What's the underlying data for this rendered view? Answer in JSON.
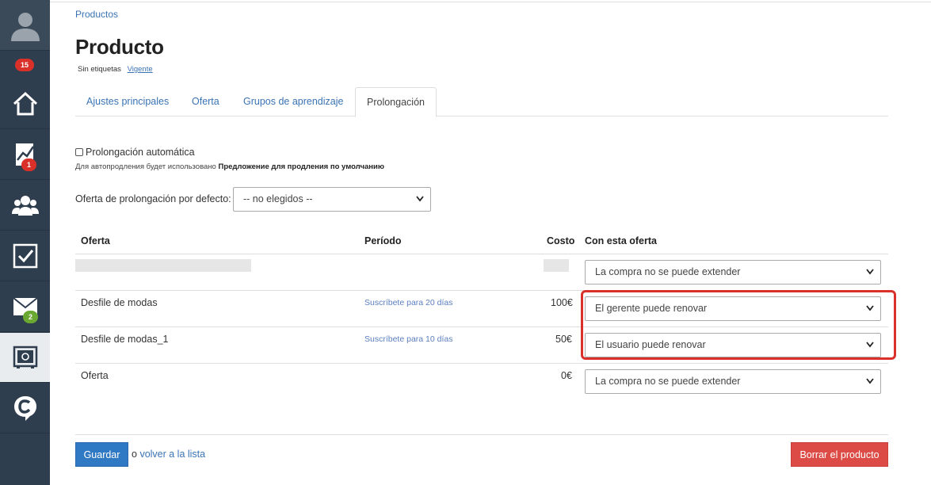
{
  "sidebar": {
    "items": [
      {
        "name": "avatar",
        "icon": "user-avatar-icon"
      },
      {
        "name": "home",
        "icon": "home-icon"
      },
      {
        "name": "stats",
        "icon": "chart-icon",
        "badge": "1"
      },
      {
        "name": "users",
        "icon": "users-group-icon"
      },
      {
        "name": "tasks",
        "icon": "checkbox-icon"
      },
      {
        "name": "messages",
        "icon": "mail-icon",
        "badge": "2"
      },
      {
        "name": "products",
        "icon": "safe-icon",
        "active": true
      },
      {
        "name": "chat",
        "icon": "chat-logo-icon"
      }
    ],
    "avatar_badge": "15"
  },
  "breadcrumb": "Productos",
  "page": {
    "title": "Producto",
    "tags_label": "Sin etiquetas",
    "status": "Vigente"
  },
  "tabs": [
    {
      "label": "Ajustes principales"
    },
    {
      "label": "Oferta"
    },
    {
      "label": "Grupos de aprendizaje"
    },
    {
      "label": "Prolongación",
      "active": true
    }
  ],
  "prolongation": {
    "auto_label": "Prolongación automática",
    "auto_checked": false,
    "note_prefix": "Для автопродления будет использовано",
    "note_bold": "Предложение для продления по умолчанию",
    "default_label": "Oferta de prolongación por defecto:",
    "default_value": "-- no elegidos --"
  },
  "table": {
    "headers": {
      "offer": "Oferta",
      "period": "Período",
      "cost": "Costo",
      "with_offer": "Con esta oferta"
    },
    "rows": [
      {
        "offer": "",
        "period": "",
        "cost": "",
        "action": "La compra no se puede extender"
      },
      {
        "offer": "Desfile de modas",
        "period": "Suscríbete para 20 días",
        "cost": "100€",
        "action": "El gerente puede renovar"
      },
      {
        "offer": "Desfile de modas_1",
        "period": "Suscríbete para 10 días",
        "cost": "50€",
        "action": "El usuario puede renovar"
      },
      {
        "offer": "Oferta",
        "period": "",
        "cost": "0€",
        "action": "La compra no se puede extender"
      }
    ]
  },
  "footer": {
    "save": "Guardar",
    "or": "o",
    "back_link": "volver a la lista",
    "delete": "Borrar el producto"
  },
  "colors": {
    "sidebar_bg": "#2f3e4e",
    "link": "#3a73b5",
    "primary_button": "#2f78c4",
    "danger_button": "#dc4b45",
    "highlight": "#d9302a"
  }
}
